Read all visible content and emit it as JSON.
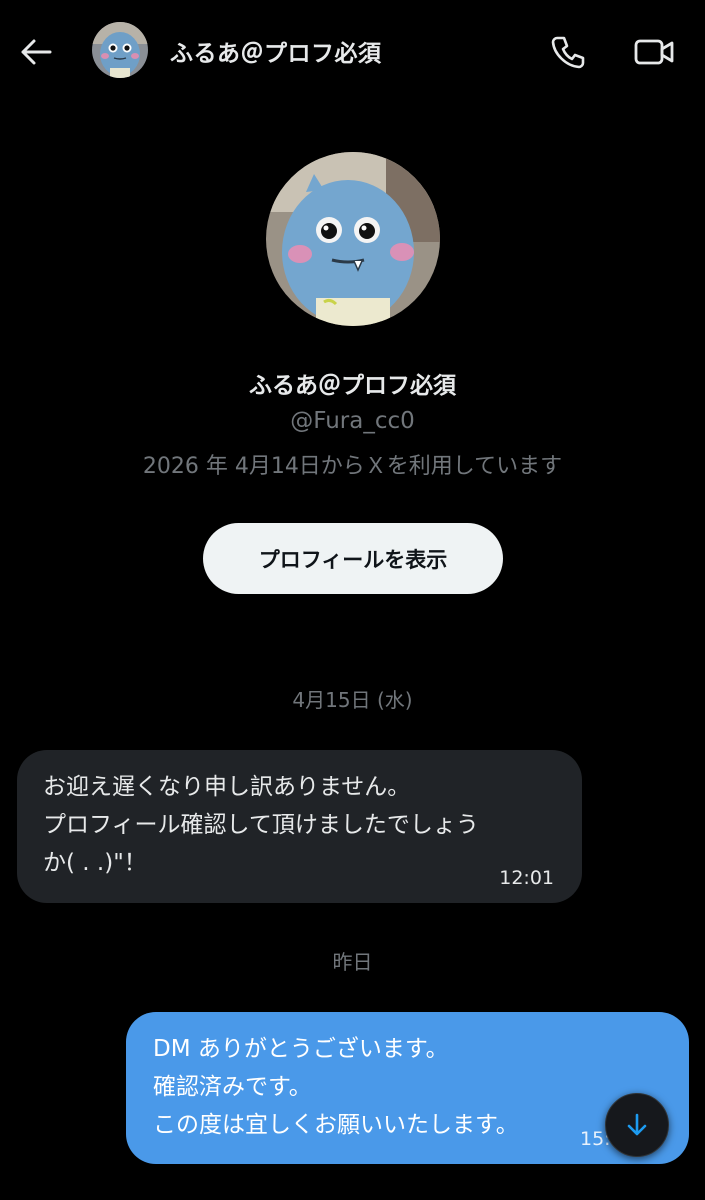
{
  "header": {
    "back_icon": "arrow-left-icon",
    "name": "ふるあ＠プロフ必須",
    "call_icon": "phone-icon",
    "video_icon": "video-camera-icon"
  },
  "profile": {
    "name": "ふるあ＠プロフ必須",
    "handle": "@Fura_cc0",
    "joined": "2026 年 4月14日からＸを利用しています",
    "view_profile_label": "プロフィールを表示"
  },
  "conversation": {
    "date_1": "4月15日 (水)",
    "incoming_message": {
      "text": "お迎え遅くなり申し訳ありません。\nプロフィール確認して頂けましたでしょう\nか(  . .)\"！",
      "time": "12:01"
    },
    "date_2": "昨日",
    "outgoing_message": {
      "text": "DM ありがとうございます。\n確認済みです。\nこの度は宜しくお願いいたします。",
      "time": "15:"
    },
    "scroll_down_icon": "arrow-down-icon"
  },
  "colors": {
    "background": "#000000",
    "incoming_bubble": "#202327",
    "outgoing_bubble": "#4a99e9",
    "secondary_text": "#71767b",
    "button_bg": "#eff3f4"
  }
}
